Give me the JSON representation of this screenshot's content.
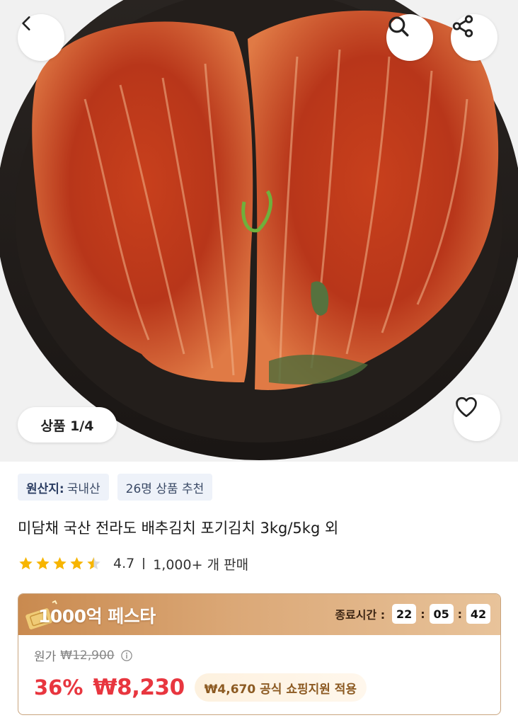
{
  "gallery": {
    "counter": "상품 1/4",
    "icons": {
      "back": "chevron-left-icon",
      "search": "search-icon",
      "share": "share-icon",
      "wishlist": "heart-icon"
    }
  },
  "product": {
    "tags": [
      {
        "label": "원산지:",
        "value": "국내산"
      },
      {
        "label": "",
        "value": "26명 상품 추천"
      }
    ],
    "title": "미담채 국산 전라도 배추김치 포기김치 3kg/5kg 외",
    "rating": "4.7",
    "sold": "1,000+ 개 판매",
    "stars_filled": 4.5
  },
  "promo": {
    "title": "1000억 페스타",
    "timer_label": "종료시간 :",
    "timer": {
      "hours": "22",
      "minutes": "05",
      "seconds": "42"
    },
    "original_label": "원가",
    "original_price": "₩12,900",
    "discount": "36%",
    "price": "₩8,230",
    "support": "₩4,670 공식 쇼핑지원 적용"
  },
  "colors": {
    "accent_red": "#e8363f",
    "promo_gold": "#c98a4f",
    "star": "#f7b500"
  }
}
